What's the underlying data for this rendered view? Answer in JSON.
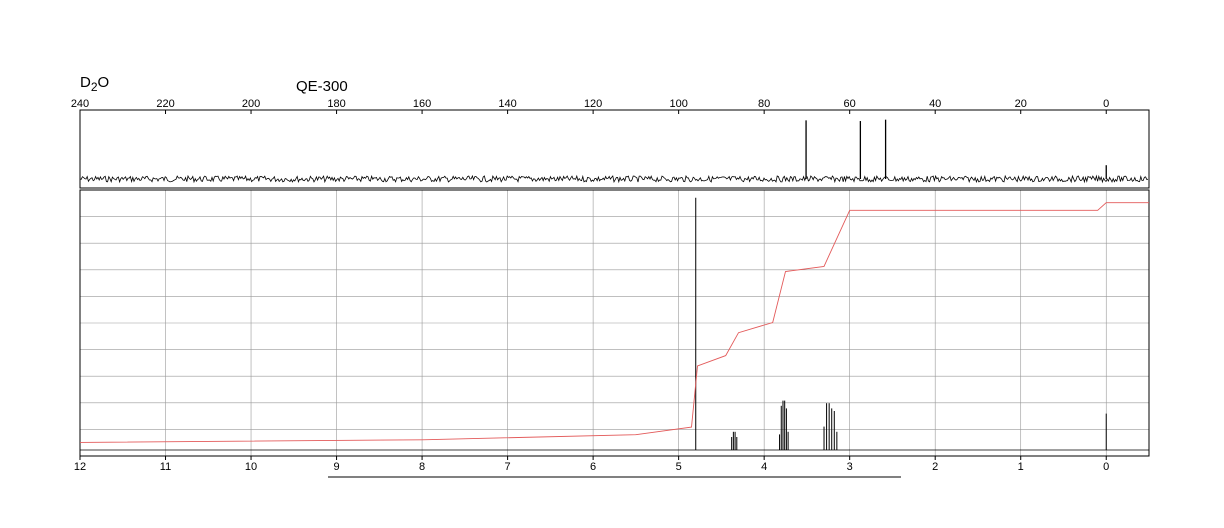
{
  "header": {
    "solvent_main": "D",
    "solvent_sub": "2",
    "solvent_tail": "O",
    "instrument": "QE-300"
  },
  "chart_data": [
    {
      "type": "line",
      "title": "",
      "xlabel": "",
      "ylabel": "",
      "x_ticks": [
        240,
        220,
        200,
        180,
        160,
        140,
        120,
        100,
        80,
        60,
        40,
        20,
        0
      ],
      "xlim": [
        240,
        -10
      ],
      "x_reversed": true,
      "peaks": [
        {
          "x": 70.2,
          "height": 0.85
        },
        {
          "x": 57.5,
          "height": 0.84
        },
        {
          "x": 51.6,
          "height": 0.86
        },
        {
          "x": 0.0,
          "height": 0.2
        }
      ],
      "grid": false
    },
    {
      "type": "line",
      "title": "",
      "xlabel": "",
      "ylabel": "",
      "x_ticks": [
        12,
        11,
        10,
        9,
        8,
        7,
        6,
        5,
        4,
        3,
        2,
        1,
        0
      ],
      "xlim": [
        12,
        -0.5
      ],
      "x_reversed": true,
      "grid": true,
      "series": [
        {
          "values": [
            {
              "x": 4.8,
              "height": 0.97
            },
            {
              "x": 4.38,
              "height": 0.05
            },
            {
              "x": 4.36,
              "height": 0.07
            },
            {
              "x": 4.34,
              "height": 0.07
            },
            {
              "x": 4.32,
              "height": 0.05
            },
            {
              "x": 3.82,
              "height": 0.06
            },
            {
              "x": 3.8,
              "height": 0.17
            },
            {
              "x": 3.78,
              "height": 0.19
            },
            {
              "x": 3.76,
              "height": 0.19
            },
            {
              "x": 3.74,
              "height": 0.16
            },
            {
              "x": 3.72,
              "height": 0.07
            },
            {
              "x": 3.3,
              "height": 0.09
            },
            {
              "x": 3.27,
              "height": 0.18
            },
            {
              "x": 3.24,
              "height": 0.18
            },
            {
              "x": 3.21,
              "height": 0.16
            },
            {
              "x": 3.18,
              "height": 0.15
            },
            {
              "x": 3.15,
              "height": 0.07
            },
            {
              "x": 0.0,
              "height": 0.14
            }
          ]
        },
        {
          "values": [
            {
              "x": 12.0,
              "y": 0.03
            },
            {
              "x": 8.0,
              "y": 0.04
            },
            {
              "x": 5.5,
              "y": 0.06
            },
            {
              "x": 4.85,
              "y": 0.09
            },
            {
              "x": 4.78,
              "y": 0.33
            },
            {
              "x": 4.45,
              "y": 0.37
            },
            {
              "x": 4.3,
              "y": 0.46
            },
            {
              "x": 3.9,
              "y": 0.5
            },
            {
              "x": 3.75,
              "y": 0.7
            },
            {
              "x": 3.3,
              "y": 0.72
            },
            {
              "x": 3.0,
              "y": 0.94
            },
            {
              "x": 0.1,
              "y": 0.94
            },
            {
              "x": 0.0,
              "y": 0.97
            },
            {
              "x": -0.5,
              "y": 0.97
            }
          ]
        }
      ],
      "underline_range": [
        9.1,
        2.4
      ]
    }
  ]
}
